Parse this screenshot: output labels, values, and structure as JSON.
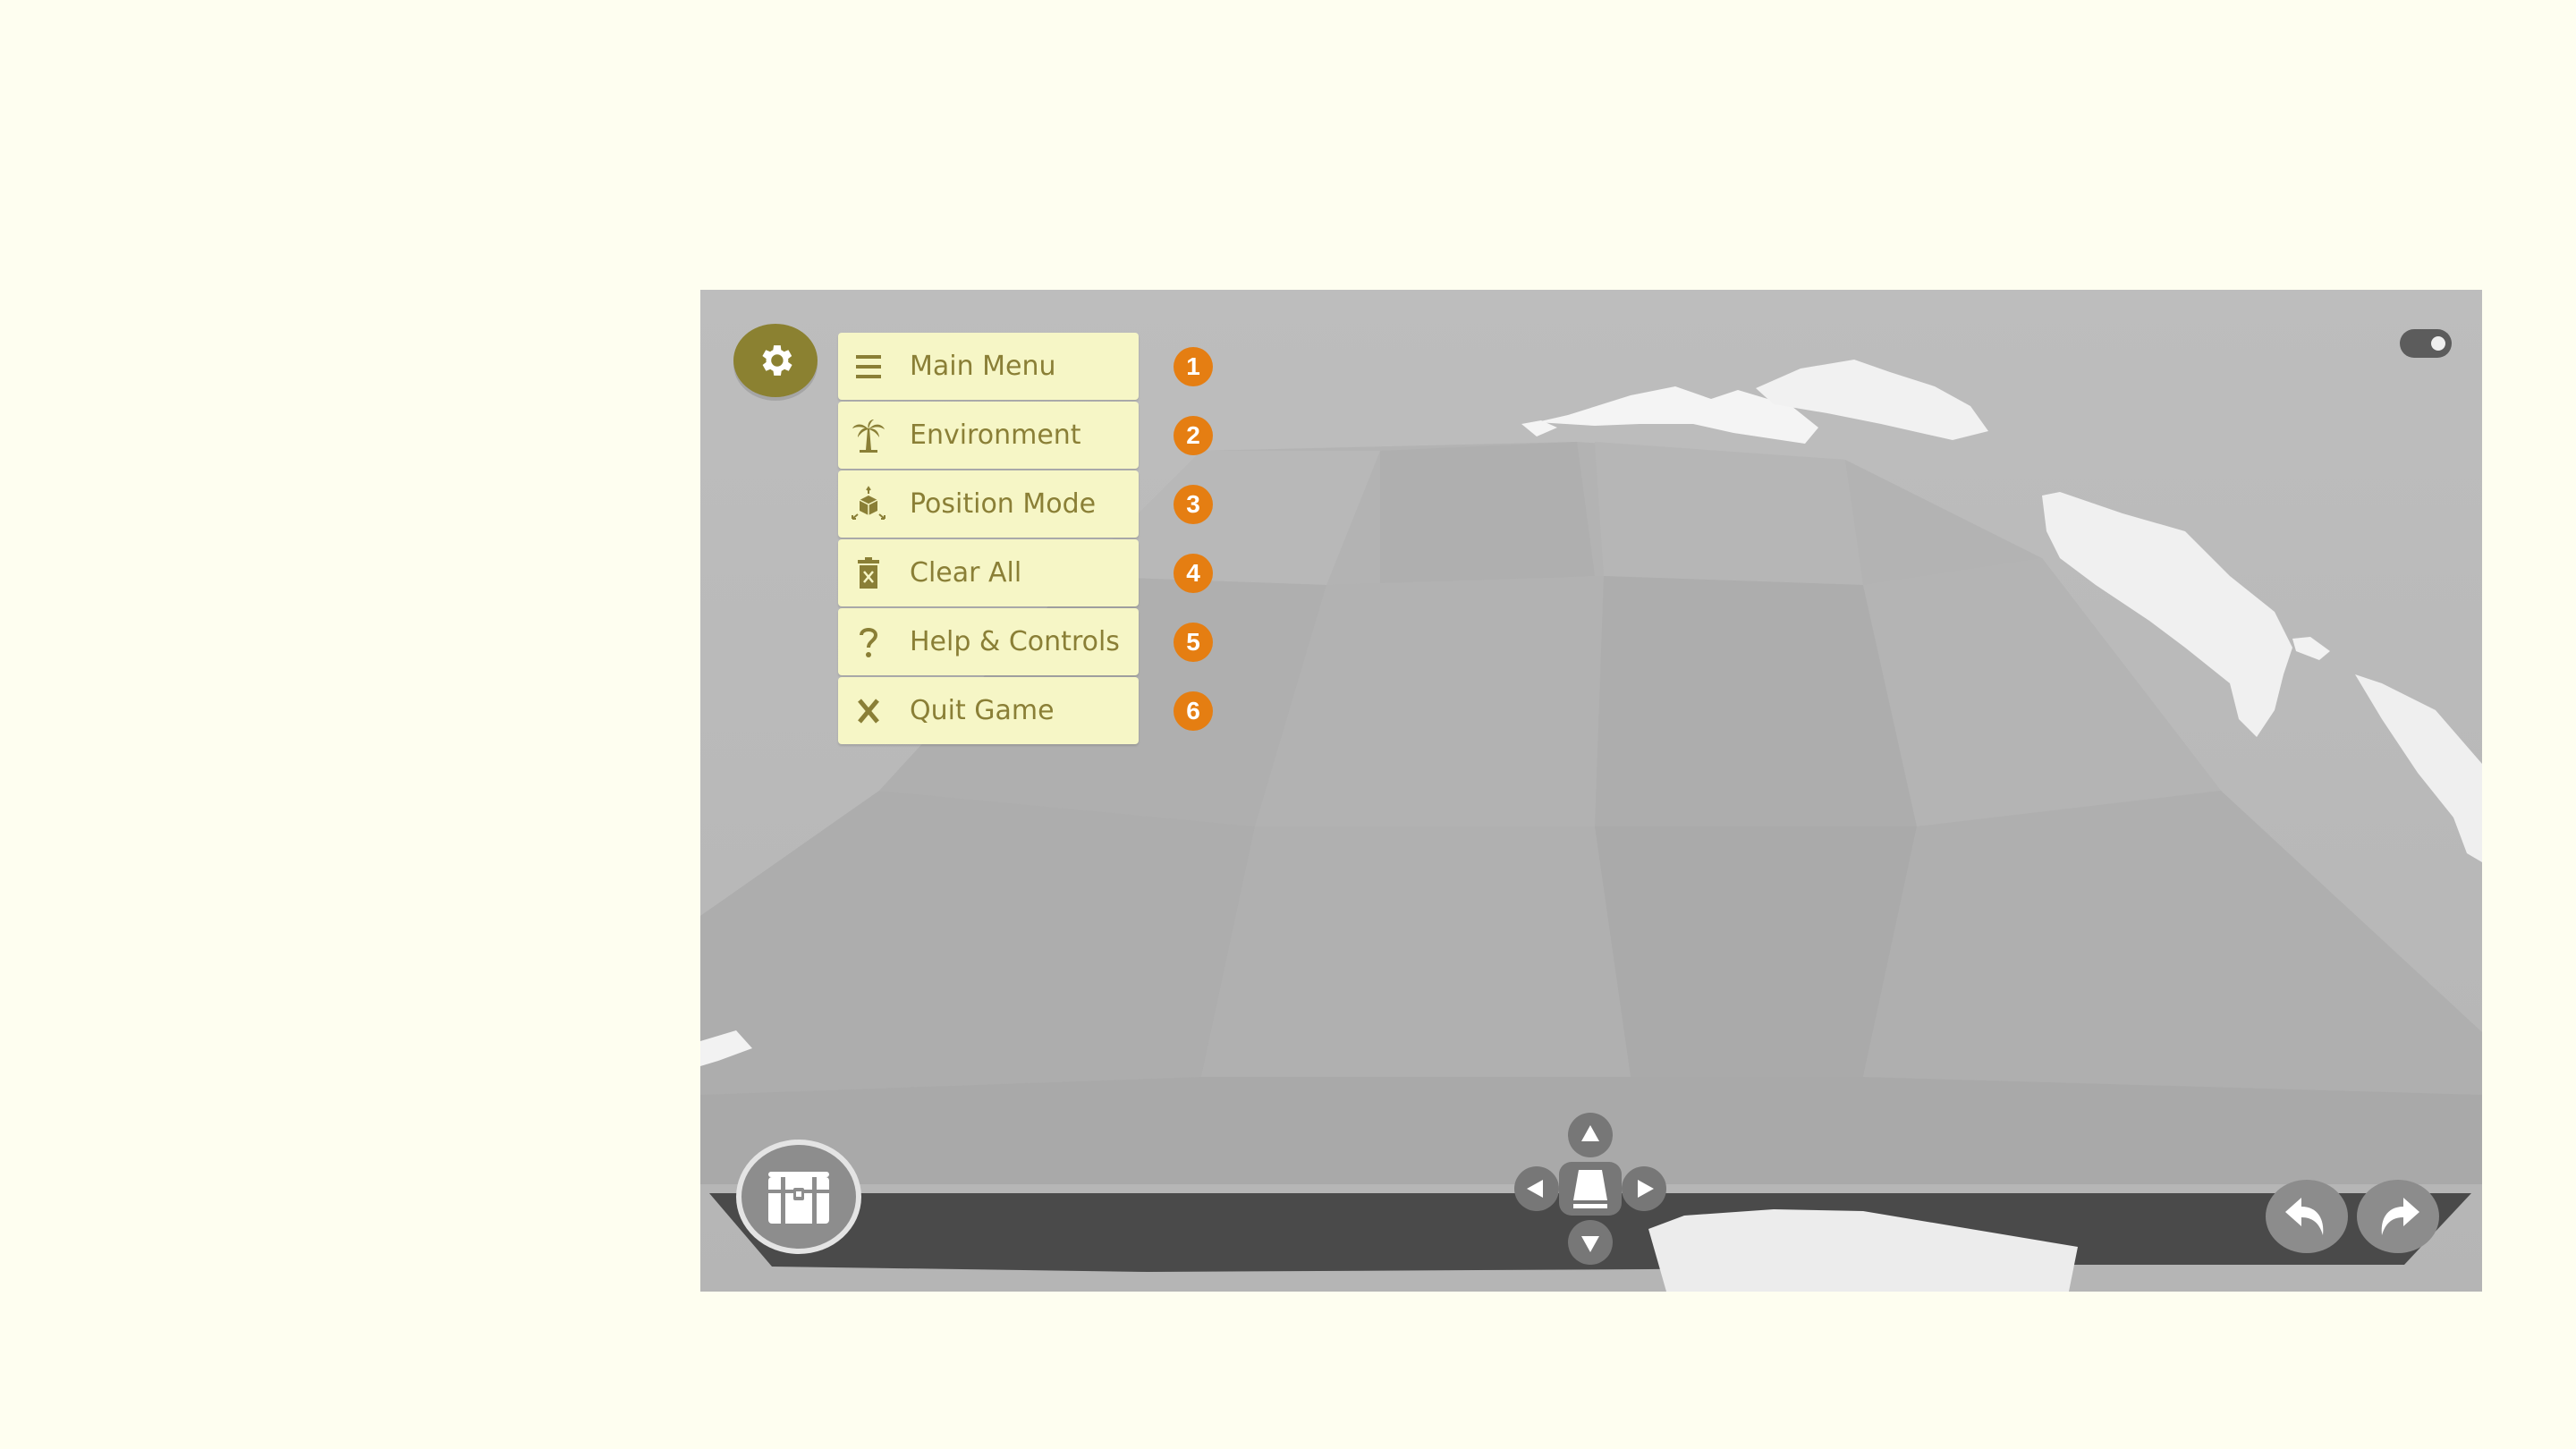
{
  "menu": {
    "items": [
      {
        "label": "Main Menu",
        "number": "1",
        "icon": "hamburger-icon"
      },
      {
        "label": "Environment",
        "number": "2",
        "icon": "palm-tree-icon"
      },
      {
        "label": "Position Mode",
        "number": "3",
        "icon": "cube-move-icon"
      },
      {
        "label": "Clear All",
        "number": "4",
        "icon": "trash-icon"
      },
      {
        "label": "Help & Controls",
        "number": "5",
        "icon": "question-icon"
      },
      {
        "label": "Quit Game",
        "number": "6",
        "icon": "x-icon"
      }
    ]
  },
  "colors": {
    "page_background": "#fefef0",
    "menu_background": "#f6f6c6",
    "menu_text": "#8a7f36",
    "badge": "#e57e12",
    "gear_button": "#8b8131",
    "scene_background": "#bcbcbc",
    "floor_band": "#4a4a4a"
  },
  "toggle": {
    "state": "on"
  }
}
